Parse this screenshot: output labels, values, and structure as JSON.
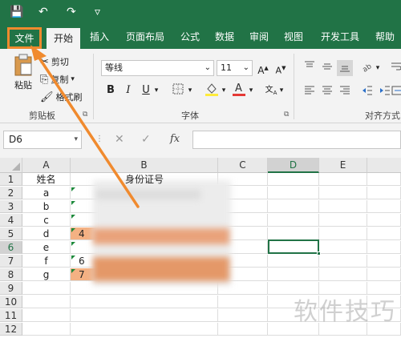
{
  "quick_access": {
    "save": "💾",
    "undo": "↶",
    "redo": "↷",
    "customize": "▿"
  },
  "tabs": [
    "文件",
    "开始",
    "插入",
    "页面布局",
    "公式",
    "数据",
    "审阅",
    "视图",
    "开发工具",
    "帮助"
  ],
  "ribbon": {
    "clipboard": {
      "paste": "粘贴",
      "cut": "剪切",
      "copy": "复制",
      "format_painter": "格式刷",
      "group": "剪贴板"
    },
    "font": {
      "name": "等线",
      "size": "11",
      "bold": "B",
      "italic": "I",
      "underline": "U",
      "group": "字体"
    },
    "alignment": {
      "group": "对齐方式"
    }
  },
  "formula_bar": {
    "name_box": "D6",
    "cancel": "✕",
    "enter": "✓",
    "fx": "fx"
  },
  "grid": {
    "columns": [
      "A",
      "B",
      "C",
      "D",
      "E"
    ],
    "rows": [
      "1",
      "2",
      "3",
      "4",
      "5",
      "6",
      "7",
      "8",
      "9",
      "10",
      "11",
      "12"
    ],
    "col_a": [
      "姓名",
      "a",
      "b",
      "c",
      "d",
      "e",
      "f",
      "g"
    ],
    "col_b_header": "身份证号",
    "col_b_partial": {
      "5": "4",
      "7": "6",
      "8": "7"
    }
  },
  "watermark": "软件技巧",
  "colors": {
    "excel_green": "#217346",
    "highlight": "#f08a2e",
    "fill_orange": "#f4b183"
  }
}
